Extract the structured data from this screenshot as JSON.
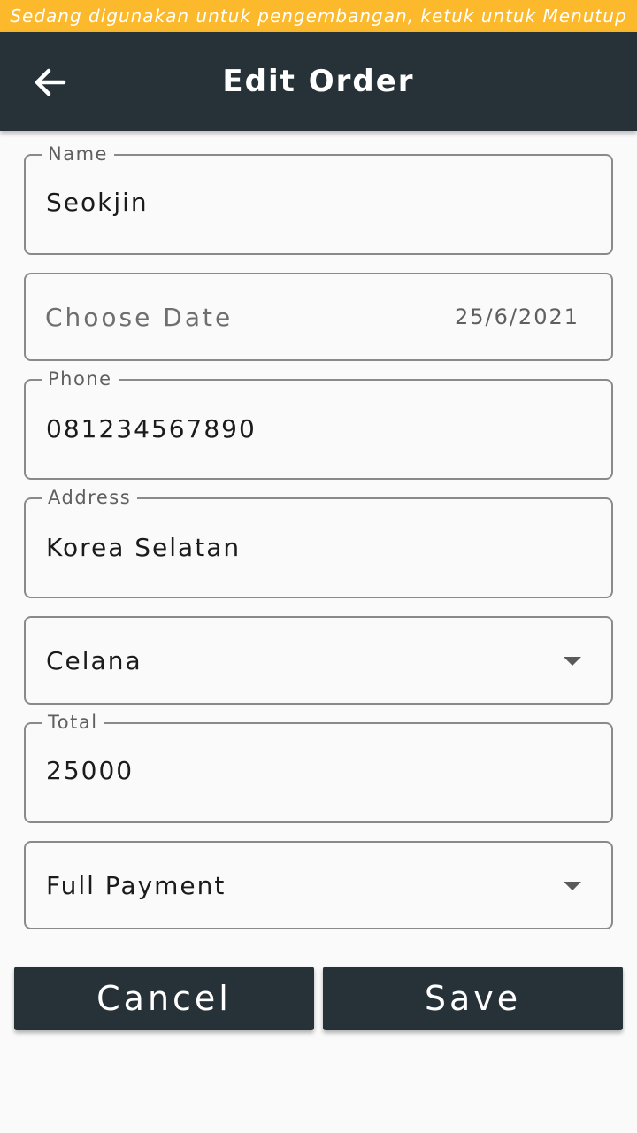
{
  "banner": {
    "text": "Sedang digunakan untuk pengembangan, ketuk untuk Menutup"
  },
  "appbar": {
    "title": "Edit Order",
    "back_icon": "arrow-left-icon"
  },
  "form": {
    "name": {
      "label": "Name",
      "value": "Seokjin"
    },
    "date": {
      "placeholder": "Choose Date",
      "value": "25/6/2021"
    },
    "phone": {
      "label": "Phone",
      "value": "081234567890"
    },
    "address": {
      "label": "Address",
      "value": "Korea Selatan"
    },
    "item": {
      "value": "Celana",
      "icon": "dropdown-arrow-icon"
    },
    "total": {
      "label": "Total",
      "value": "25000"
    },
    "payment": {
      "value": "Full Payment",
      "icon": "dropdown-arrow-icon"
    }
  },
  "actions": {
    "cancel_label": "Cancel",
    "save_label": "Save"
  },
  "colors": {
    "banner": "#fbb92b",
    "primary_dark": "#263238",
    "background": "#fafafa",
    "border": "#8a8a8a"
  }
}
